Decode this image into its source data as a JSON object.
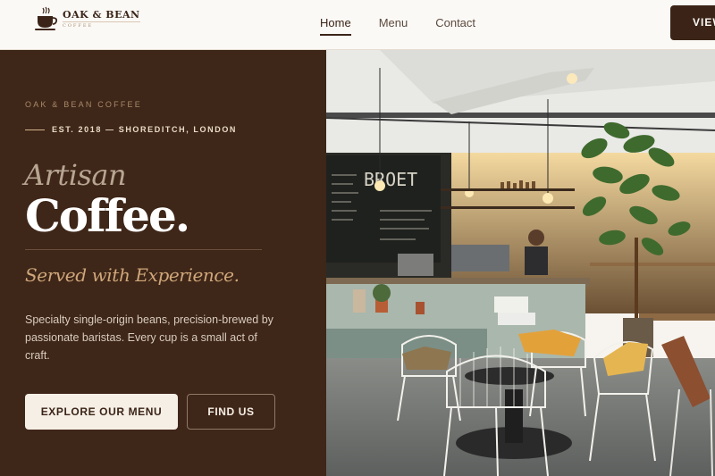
{
  "brand": {
    "name": "OAK & BEAN",
    "sub": "COFFEE",
    "logo_icon": "coffee-cup-icon"
  },
  "nav": {
    "links": [
      {
        "label": "Home",
        "active": true
      },
      {
        "label": "Menu",
        "active": false
      },
      {
        "label": "Contact",
        "active": false
      }
    ],
    "cta_label": "VIEW"
  },
  "hero": {
    "eyebrow": "OAK & BEAN COFFEE",
    "est": "EST. 2018 — SHOREDITCH, LONDON",
    "heading_light": "Artisan",
    "heading_bold": "Coffee.",
    "tagline": "Served with Experience.",
    "description": "Specialty single-origin beans, precision-brewed by passionate baristas. Every cup is a small act of craft.",
    "primary_button": "EXPLORE OUR MENU",
    "secondary_button": "FIND US"
  },
  "photo": {
    "chalkboard_text": "BROET"
  },
  "colors": {
    "espresso": "#3e2618",
    "cream": "#f6efe6",
    "caramel": "#cfa77a",
    "nav_bg": "#fbf9f6"
  }
}
